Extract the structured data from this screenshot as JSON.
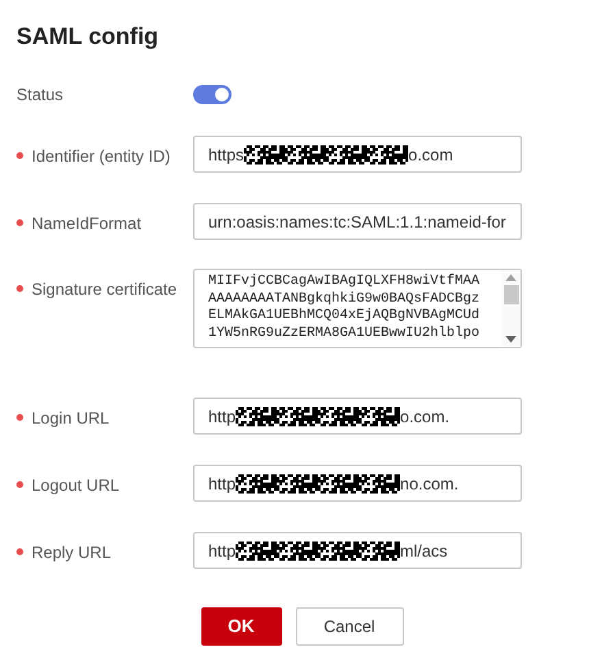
{
  "title": "SAML config",
  "status": {
    "label": "Status",
    "on": true
  },
  "fields": [
    {
      "kind": "input",
      "label": "Identifier (entity ID)",
      "required": true,
      "value_start": "https",
      "redacted": true,
      "value_end": "o.com"
    },
    {
      "kind": "input",
      "label": "NameIdFormat",
      "required": true,
      "value_start": "urn:oasis:names:tc:SAML:1.1:nameid-for",
      "redacted": false
    },
    {
      "kind": "textarea",
      "label": "Signature certificate",
      "required": true,
      "lines": [
        "MIIFvjCCBCagAwIBAgIQLXFH8wiVtfMAA",
        "AAAAAAAATANBgkqhkiG9w0BAQsFADCBgz",
        "ELMAkGA1UEBhMCQ04xEjAQBgNVBAgMCUd",
        "1YW5nRG9uZzERMA8GA1UEBwwIU2hlblpo"
      ]
    },
    {
      "kind": "input",
      "label": "Login URL",
      "required": true,
      "value_start": "http",
      "redacted": true,
      "value_end": "o.com."
    },
    {
      "kind": "input",
      "label": "Logout URL",
      "required": true,
      "value_start": "http",
      "redacted": true,
      "value_end": "no.com."
    },
    {
      "kind": "input",
      "label": "Reply URL",
      "required": true,
      "value_start": "http",
      "redacted": true,
      "value_end": "ml/acs"
    }
  ],
  "buttons": [
    {
      "label": "OK",
      "kind": "primary"
    },
    {
      "label": "Cancel",
      "kind": "secondary"
    }
  ]
}
